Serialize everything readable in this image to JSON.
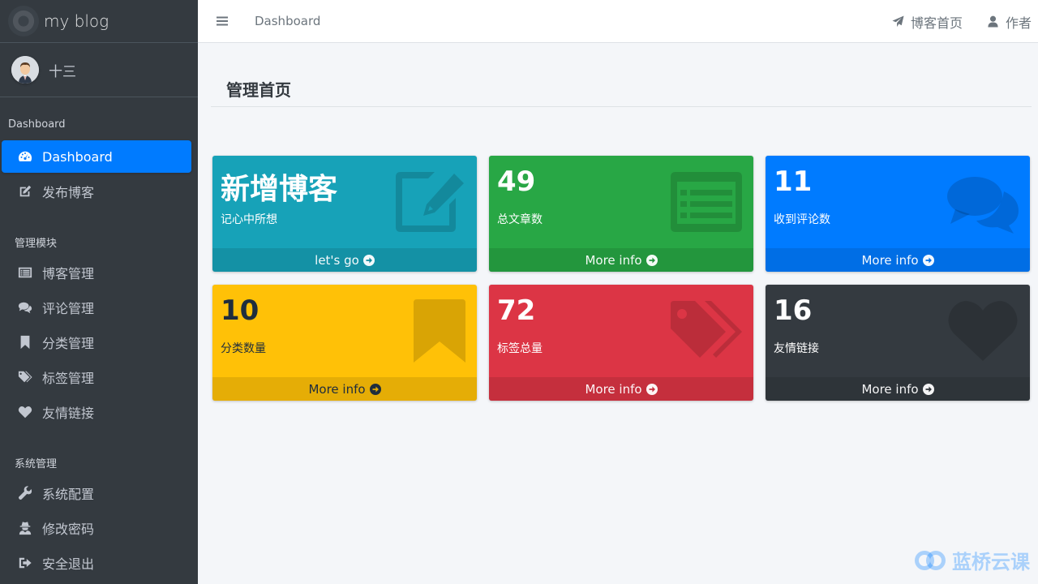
{
  "app": {
    "brand": "my blog"
  },
  "user": {
    "name": "十三"
  },
  "sidebar": {
    "section1": "Dashboard",
    "items1": [
      {
        "label": "Dashboard",
        "icon": "dashboard-icon",
        "active": true
      },
      {
        "label": "发布博客",
        "icon": "edit-icon",
        "active": false
      }
    ],
    "section2": "管理模块",
    "items2": [
      {
        "label": "博客管理",
        "icon": "list-icon"
      },
      {
        "label": "评论管理",
        "icon": "comments-icon"
      },
      {
        "label": "分类管理",
        "icon": "bookmark-icon"
      },
      {
        "label": "标签管理",
        "icon": "tags-icon"
      },
      {
        "label": "友情链接",
        "icon": "heart-icon"
      }
    ],
    "section3": "系统管理",
    "items3": [
      {
        "label": "系统配置",
        "icon": "wrench-icon"
      },
      {
        "label": "修改密码",
        "icon": "user-secret-icon"
      },
      {
        "label": "安全退出",
        "icon": "sign-out-icon"
      }
    ]
  },
  "topbar": {
    "breadcrumb": "Dashboard",
    "home_link": "博客首页",
    "author_link": "作者"
  },
  "page": {
    "title": "管理首页"
  },
  "cards": [
    {
      "value": "新增博客",
      "label": "记心中所想",
      "footer": "let's go",
      "color": "#17a2b8",
      "icon": "edit-icon"
    },
    {
      "value": "49",
      "label": "总文章数",
      "footer": "More info",
      "color": "#28a745",
      "icon": "list-alt-icon"
    },
    {
      "value": "11",
      "label": "收到评论数",
      "footer": "More info",
      "color": "#007bff",
      "icon": "comments-icon"
    },
    {
      "value": "10",
      "label": "分类数量",
      "footer": "More info",
      "color": "#ffc107",
      "icon": "bookmark-icon"
    },
    {
      "value": "72",
      "label": "标签总量",
      "footer": "More info",
      "color": "#dc3545",
      "icon": "tags-icon"
    },
    {
      "value": "16",
      "label": "友情链接",
      "footer": "More info",
      "color": "#343a40",
      "icon": "heart-icon"
    }
  ],
  "watermark": "蓝桥云课"
}
